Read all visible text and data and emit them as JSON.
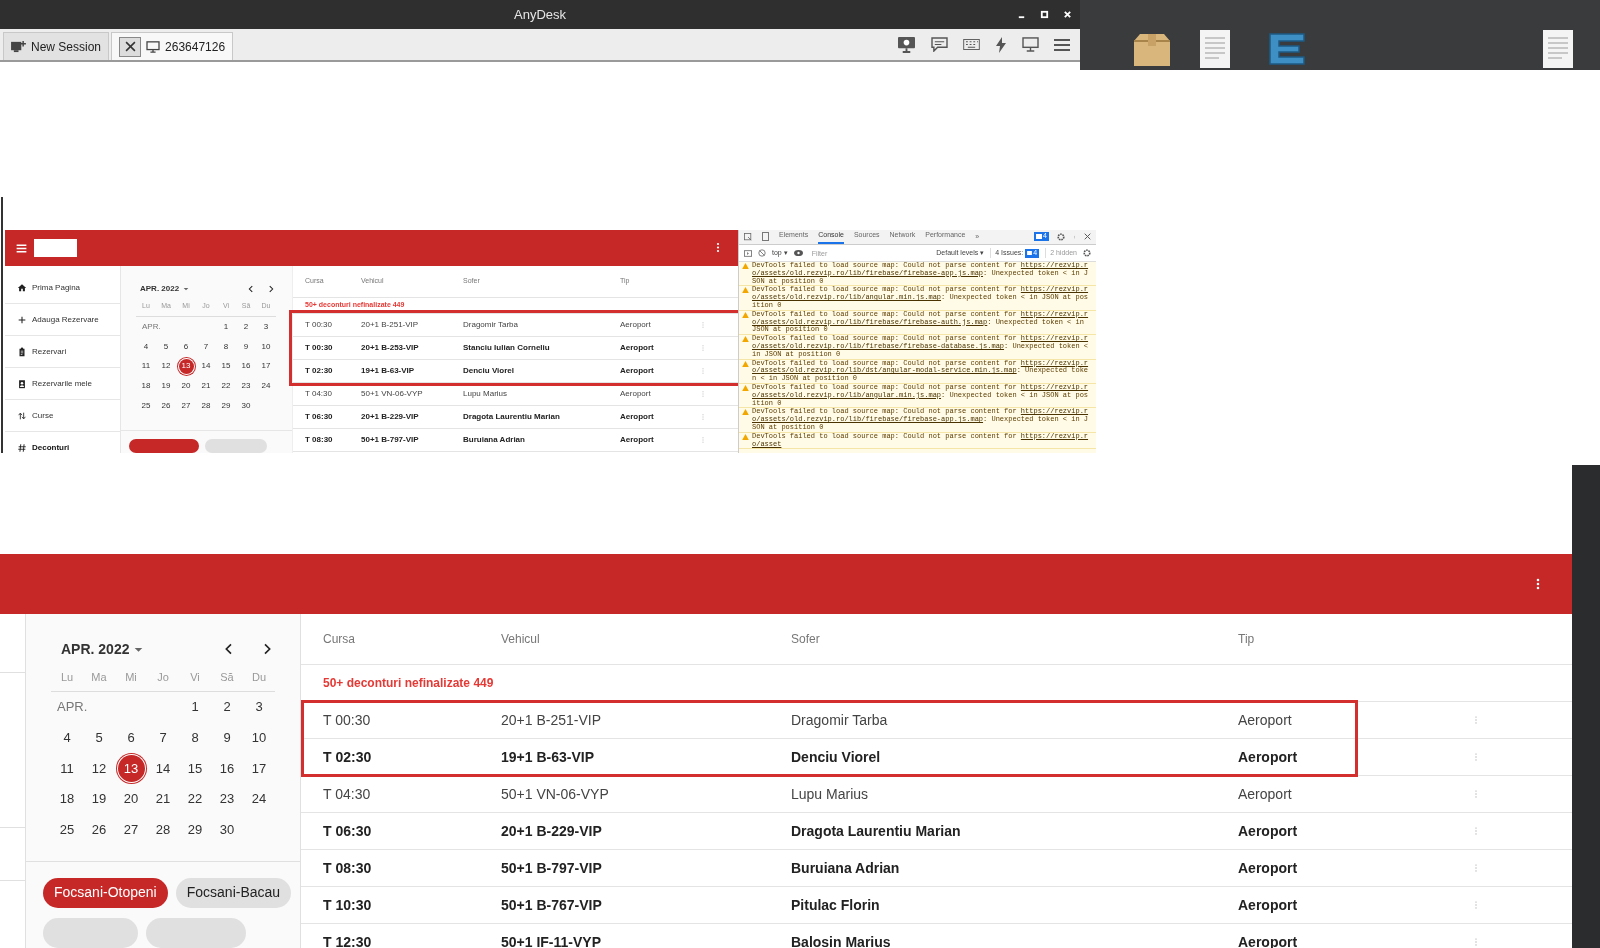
{
  "anydesk": {
    "title": "AnyDesk",
    "tabs": [
      {
        "kind": "new",
        "label": "New Session",
        "selected": false
      },
      {
        "kind": "session",
        "label": "263647126",
        "selected": true
      }
    ]
  },
  "small_capture": {
    "sidebar": {
      "items": [
        {
          "label": "Prima Pagina",
          "selected": false
        },
        {
          "label": "Adauga Rezervare",
          "selected": false
        },
        {
          "label": "Rezervari",
          "selected": false
        },
        {
          "label": "Rezervarile mele",
          "selected": false
        },
        {
          "label": "Curse",
          "selected": false
        },
        {
          "label": "Deconturi",
          "selected": true
        }
      ]
    },
    "calendar": {
      "month": "APR. 2022",
      "weekdays": [
        "Lu",
        "Ma",
        "Mi",
        "Jo",
        "Vi",
        "Să",
        "Du"
      ],
      "weeks": [
        {
          "label": "APR.",
          "days": [
            {
              "day": "1",
              "selected": false
            },
            {
              "day": "2",
              "selected": false
            },
            {
              "day": "3",
              "selected": false
            }
          ]
        },
        {
          "days": [
            {
              "day": "4",
              "selected": false
            },
            {
              "day": "5",
              "selected": false
            },
            {
              "day": "6",
              "selected": false
            },
            {
              "day": "7",
              "selected": false
            },
            {
              "day": "8",
              "selected": false
            },
            {
              "day": "9",
              "selected": false
            },
            {
              "day": "10",
              "selected": false
            }
          ]
        },
        {
          "days": [
            {
              "day": "11",
              "selected": false
            },
            {
              "day": "12",
              "selected": false
            },
            {
              "day": "13",
              "selected": true
            },
            {
              "day": "14",
              "selected": false
            },
            {
              "day": "15",
              "selected": false
            },
            {
              "day": "16",
              "selected": false
            },
            {
              "day": "17",
              "selected": false
            }
          ]
        },
        {
          "days": [
            {
              "day": "18",
              "selected": false
            },
            {
              "day": "19",
              "selected": false
            },
            {
              "day": "20",
              "selected": false
            },
            {
              "day": "21",
              "selected": false
            },
            {
              "day": "22",
              "selected": false
            },
            {
              "day": "23",
              "selected": false
            },
            {
              "day": "24",
              "selected": false
            }
          ]
        },
        {
          "days": [
            {
              "day": "25",
              "selected": false
            },
            {
              "day": "26",
              "selected": false
            },
            {
              "day": "27",
              "selected": false
            },
            {
              "day": "28",
              "selected": false
            },
            {
              "day": "29",
              "selected": false
            },
            {
              "day": "30",
              "selected": false
            }
          ]
        }
      ]
    },
    "table": {
      "columns": [
        "Cursa",
        "Vehicul",
        "Sofer",
        "Tip"
      ],
      "notice": "50+ deconturi nefinalizate 449",
      "rows": [
        {
          "cells": [
            "T 00:30",
            "20+1 B-251-VIP",
            "Dragomir Tarba",
            "Aeroport"
          ],
          "bold": false,
          "highlighted": true
        },
        {
          "cells": [
            "T 00:30",
            "20+1 B-253-VIP",
            "Stanciu Iulian Corneliu",
            "Aeroport"
          ],
          "bold": true,
          "highlighted": true
        },
        {
          "cells": [
            "T 02:30",
            "19+1 B-63-VIP",
            "Denciu Viorel",
            "Aeroport"
          ],
          "bold": true,
          "highlighted": true
        },
        {
          "cells": [
            "T 04:30",
            "50+1 VN-06-VYP",
            "Lupu Marius",
            "Aeroport"
          ],
          "bold": false,
          "highlighted": false
        },
        {
          "cells": [
            "T 06:30",
            "20+1 B-229-VIP",
            "Dragota Laurentiu Marian",
            "Aeroport"
          ],
          "bold": true,
          "highlighted": false
        },
        {
          "cells": [
            "T 08:30",
            "50+1 B-797-VIP",
            "Buruiana Adrian",
            "Aeroport"
          ],
          "bold": true,
          "highlighted": false
        }
      ]
    },
    "devtools": {
      "tabs": [
        {
          "label": "Elements",
          "selected": false
        },
        {
          "label": "Console",
          "selected": true
        },
        {
          "label": "Sources",
          "selected": false
        },
        {
          "label": "Network",
          "selected": false
        },
        {
          "label": "Performance",
          "selected": false
        }
      ],
      "more": "»",
      "issues_badge": "4",
      "context": "top ▾",
      "filter_placeholder": "Filter",
      "levels": "Default levels ▾",
      "issues_label": "4 Issues:",
      "issues_count": "4",
      "hidden": "2 hidden",
      "messages": [
        {
          "before": "DevTools failed to load source map: Could not parse content for ",
          "url": "https://rezvip.ro/assets/old.rezvip.ro/lib/firebase/firebase-app.js.map",
          "after": ": Unexpected token < in JSON at position 0"
        },
        {
          "before": "DevTools failed to load source map: Could not parse content for ",
          "url": "https://rezvip.ro/assets/old.rezvip.ro/lib/angular.min.js.map",
          "after": ": Unexpected token < in JSON at position 0"
        },
        {
          "before": "DevTools failed to load source map: Could not parse content for ",
          "url": "https://rezvip.ro/assets/old.rezvip.ro/lib/firebase/firebase-auth.js.map",
          "after": ": Unexpected token < in JSON at position 0"
        },
        {
          "before": "DevTools failed to load source map: Could not parse content for ",
          "url": "https://rezvip.ro/assets/old.rezvip.ro/lib/firebase/firebase-database.js.map",
          "after": ": Unexpected token < in JSON at position 0"
        },
        {
          "before": "DevTools failed to load source map: Could not parse content for ",
          "url": "https://rezvip.ro/assets/old.rezvip.ro/lib/dst/angular-modal-service.min.js.map",
          "after": ": Unexpected token < in JSON at position 0"
        },
        {
          "before": "DevTools failed to load source map: Could not parse content for ",
          "url": "https://rezvip.ro/assets/old.rezvip.ro/lib/angular.min.js.map",
          "after": ": Unexpected token < in JSON at position 0"
        },
        {
          "before": "DevTools failed to load source map: Could not parse content for ",
          "url": "https://rezvip.ro/assets/old.rezvip.ro/lib/firebase/firebase-app.js.map",
          "after": ": Unexpected token < in JSON at position 0"
        },
        {
          "before": "DevTools failed to load source map: Could not parse content for ",
          "url": "https://rezvip.ro/asset"
        }
      ]
    }
  },
  "large_capture": {
    "calendar": {
      "month": "APR. 2022",
      "weekdays": [
        "Lu",
        "Ma",
        "Mi",
        "Jo",
        "Vi",
        "Să",
        "Du"
      ],
      "weeks": [
        {
          "label": "APR.",
          "days": [
            {
              "day": "1",
              "selected": false
            },
            {
              "day": "2",
              "selected": false
            },
            {
              "day": "3",
              "selected": false
            }
          ]
        },
        {
          "days": [
            {
              "day": "4",
              "selected": false
            },
            {
              "day": "5",
              "selected": false
            },
            {
              "day": "6",
              "selected": false
            },
            {
              "day": "7",
              "selected": false
            },
            {
              "day": "8",
              "selected": false
            },
            {
              "day": "9",
              "selected": false
            },
            {
              "day": "10",
              "selected": false
            }
          ]
        },
        {
          "days": [
            {
              "day": "11",
              "selected": false
            },
            {
              "day": "12",
              "selected": false
            },
            {
              "day": "13",
              "selected": true
            },
            {
              "day": "14",
              "selected": false
            },
            {
              "day": "15",
              "selected": false
            },
            {
              "day": "16",
              "selected": false
            },
            {
              "day": "17",
              "selected": false
            }
          ]
        },
        {
          "days": [
            {
              "day": "18",
              "selected": false
            },
            {
              "day": "19",
              "selected": false
            },
            {
              "day": "20",
              "selected": false
            },
            {
              "day": "21",
              "selected": false
            },
            {
              "day": "22",
              "selected": false
            },
            {
              "day": "23",
              "selected": false
            },
            {
              "day": "24",
              "selected": false
            }
          ]
        },
        {
          "days": [
            {
              "day": "25",
              "selected": false
            },
            {
              "day": "26",
              "selected": false
            },
            {
              "day": "27",
              "selected": false
            },
            {
              "day": "28",
              "selected": false
            },
            {
              "day": "29",
              "selected": false
            },
            {
              "day": "30",
              "selected": false
            }
          ]
        }
      ]
    },
    "chips": [
      {
        "label": "Focsani-Otopeni",
        "selected": true
      },
      {
        "label": "Focsani-Bacau",
        "selected": false
      }
    ],
    "table": {
      "columns": [
        "Cursa",
        "Vehicul",
        "Sofer",
        "Tip"
      ],
      "notice": "50+ deconturi nefinalizate 449",
      "rows": [
        {
          "cells": [
            "T 00:30",
            "20+1 B-251-VIP",
            "Dragomir Tarba",
            "Aeroport"
          ],
          "bold": false,
          "highlighted": true
        },
        {
          "cells": [
            "T 02:30",
            "19+1 B-63-VIP",
            "Denciu Viorel",
            "Aeroport"
          ],
          "bold": true,
          "highlighted": true
        },
        {
          "cells": [
            "T 04:30",
            "50+1 VN-06-VYP",
            "Lupu Marius",
            "Aeroport"
          ],
          "bold": false,
          "highlighted": false
        },
        {
          "cells": [
            "T 06:30",
            "20+1 B-229-VIP",
            "Dragota Laurentiu Marian",
            "Aeroport"
          ],
          "bold": true,
          "highlighted": false
        },
        {
          "cells": [
            "T 08:30",
            "50+1 B-797-VIP",
            "Buruiana Adrian",
            "Aeroport"
          ],
          "bold": true,
          "highlighted": false
        },
        {
          "cells": [
            "T 10:30",
            "50+1 B-767-VIP",
            "Pitulac Florin",
            "Aeroport"
          ],
          "bold": true,
          "highlighted": false
        },
        {
          "cells": [
            "T 12:30",
            "50+1 IF-11-VYP",
            "Balosin Marius",
            "Aeroport"
          ],
          "bold": true,
          "highlighted": false
        }
      ]
    }
  }
}
